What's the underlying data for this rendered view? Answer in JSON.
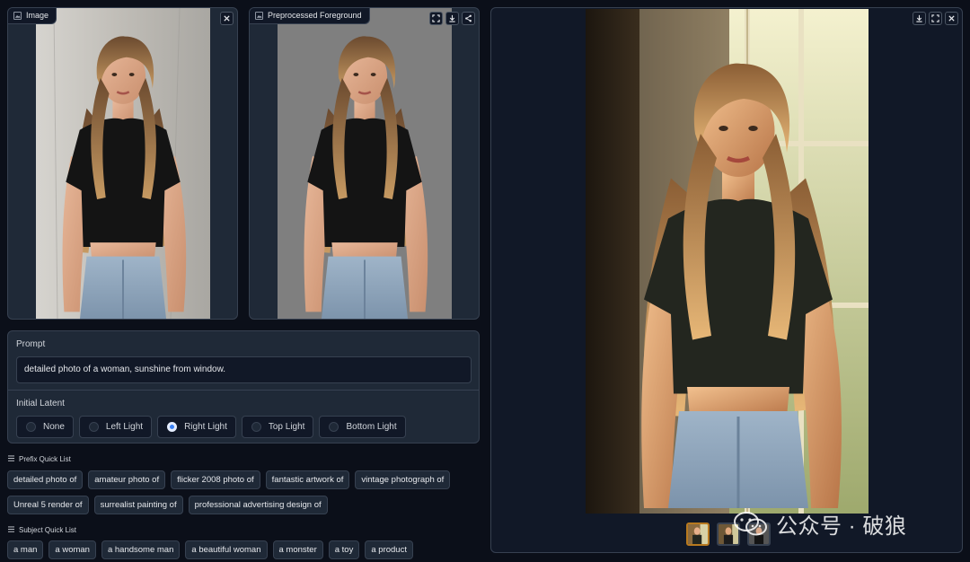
{
  "input_panel": {
    "label": "Image"
  },
  "fg_panel": {
    "label": "Preprocessed Foreground"
  },
  "prompt": {
    "title": "Prompt",
    "value": "detailed photo of a woman, sunshine from window."
  },
  "initial_latent": {
    "title": "Initial Latent",
    "options": [
      "None",
      "Left Light",
      "Right Light",
      "Top Light",
      "Bottom Light"
    ],
    "selected": "Right Light"
  },
  "prefix_quick_list": {
    "title": "Prefix Quick List",
    "rows": [
      [
        "detailed photo of",
        "amateur photo of",
        "flicker 2008 photo of",
        "fantastic artwork of",
        "vintage photograph of"
      ],
      [
        "Unreal 5 render of",
        "surrealist painting of",
        "professional advertising design of"
      ]
    ]
  },
  "subject_quick_list": {
    "title": "Subject Quick List",
    "items": [
      "a man",
      "a woman",
      "a handsome man",
      "a beautiful woman",
      "a monster",
      "a toy",
      "a product"
    ]
  },
  "watermark": {
    "text": "公众号 · 破狼"
  },
  "icons": {
    "input": [
      "image-icon",
      "close-icon"
    ],
    "fg": [
      "image-icon",
      "fullscreen-icon",
      "download-icon",
      "share-icon"
    ],
    "output": [
      "download-icon",
      "fullscreen-icon",
      "close-icon"
    ]
  }
}
